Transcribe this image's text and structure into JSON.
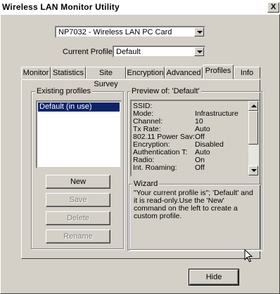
{
  "window": {
    "title": "Wireless LAN Monitor Utility",
    "close_label": "X"
  },
  "adapter": {
    "selected": "NP7032 - Wireless LAN PC Card"
  },
  "profile": {
    "label": "Current Profile:",
    "selected": "Default"
  },
  "tabs": [
    "Monitor",
    "Statistics",
    "Site Survey",
    "Encryption",
    "Advanced",
    "Profiles",
    "Info"
  ],
  "active_tab": "Profiles",
  "existing": {
    "label": "Existing profiles",
    "items": [
      "Default (in use)"
    ]
  },
  "buttons": {
    "new": "New",
    "save": "Save",
    "delete": "Delete",
    "rename": "Rename",
    "hide": "Hide"
  },
  "preview": {
    "label": "Preview of: 'Default'",
    "rows": [
      {
        "k": "SSID:",
        "v": ""
      },
      {
        "k": "Mode:",
        "v": "Infrastructure"
      },
      {
        "k": "Channel:",
        "v": "10"
      },
      {
        "k": "Tx Rate:",
        "v": "Auto"
      },
      {
        "k": "802.11 Power Sav:",
        "v": "Off"
      },
      {
        "k": "Encryption:",
        "v": "Disabled"
      },
      {
        "k": "Authentication T:",
        "v": "Auto"
      },
      {
        "k": "Radio:",
        "v": "On"
      },
      {
        "k": "Int. Roaming:",
        "v": "Off"
      }
    ]
  },
  "wizard": {
    "label": "Wizard",
    "text": "\"Your current profile is\"; 'Default' and it is read-only.Use the 'New' command on the left to create a custom profile."
  }
}
